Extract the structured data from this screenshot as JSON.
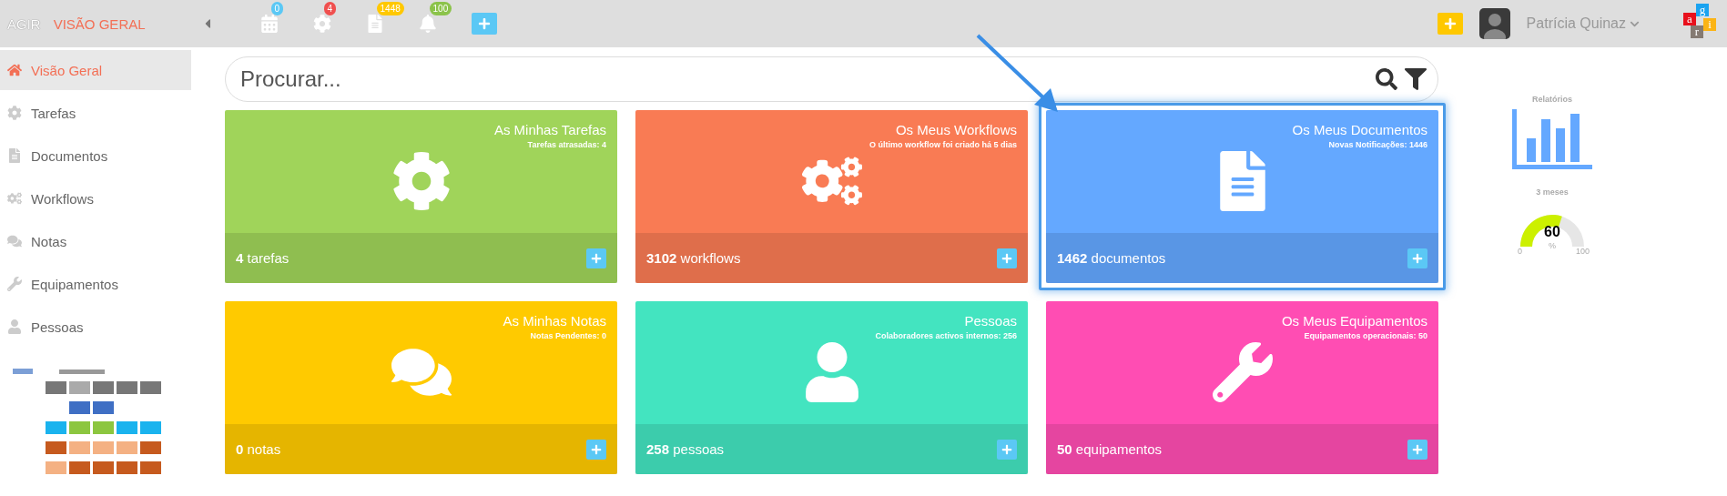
{
  "topbar": {
    "brand": "AGIR",
    "section": "VISÃO GERAL",
    "notifications": [
      {
        "kind": "calendar",
        "count": "0",
        "color": "#5bc8f5"
      },
      {
        "kind": "gear",
        "count": "4",
        "color": "#f0504f"
      },
      {
        "kind": "document",
        "count": "1448",
        "color": "#ffc800"
      },
      {
        "kind": "bell",
        "count": "100",
        "color": "#8bc34a"
      }
    ],
    "user": {
      "name": "Patrícia Quinaz"
    },
    "logo": [
      {
        "letter": "a",
        "color": "#e8101c"
      },
      {
        "letter": "g",
        "color": "#1aa3f0"
      },
      {
        "letter": "r",
        "color": "#857a72"
      },
      {
        "letter": "i",
        "color": "#fbb416"
      }
    ]
  },
  "sidebar": {
    "items": [
      {
        "kind": "home",
        "label": "Visão Geral",
        "selected": true
      },
      {
        "kind": "gear",
        "label": "Tarefas",
        "selected": false
      },
      {
        "kind": "document",
        "label": "Documentos",
        "selected": false
      },
      {
        "kind": "cogs",
        "label": "Workflows",
        "selected": false
      },
      {
        "kind": "comments",
        "label": "Notas",
        "selected": false
      },
      {
        "kind": "wrench",
        "label": "Equipamentos",
        "selected": false
      },
      {
        "kind": "user",
        "label": "Pessoas",
        "selected": false
      }
    ]
  },
  "search": {
    "placeholder": "Procurar..."
  },
  "tiles": [
    {
      "kind": "gear",
      "title": "As Minhas Tarefas",
      "subtitle": "Tarefas atrasadas: 4",
      "footer": "**4** tarefas",
      "color": "#a0d45a",
      "selected": false
    },
    {
      "kind": "cogs",
      "title": "Os Meus Workflows",
      "subtitle": "O último workflow foi criado há 5 dias",
      "footer": "**3102** workflows",
      "color": "#f97b54",
      "selected": false
    },
    {
      "kind": "document",
      "title": "Os Meus Documentos",
      "subtitle": "Novas Notificações: 1446",
      "footer": "**1462** documentos",
      "color": "#64a8ff",
      "selected": true
    },
    {
      "kind": "comments",
      "title": "As Minhas Notas",
      "subtitle": "Notas Pendentes: 0",
      "footer": "**0** notas",
      "color": "#ffca00",
      "selected": false
    },
    {
      "kind": "user",
      "title": "Pessoas",
      "subtitle": "Colaboradores activos internos: 256",
      "footer": "**258** pessoas",
      "color": "#43e4c0",
      "selected": false
    },
    {
      "kind": "wrench",
      "title": "Os Meus Equipamentos",
      "subtitle": "Equipamentos operacionais: 50",
      "footer": "**50** equipamentos",
      "color": "#ff4db3",
      "selected": false
    }
  ],
  "reports": {
    "title": "Relatórios"
  },
  "gauge": {
    "title": "3 meses",
    "level": 0.6,
    "reading": "60",
    "unit": "%",
    "min": "0",
    "max": "100"
  }
}
